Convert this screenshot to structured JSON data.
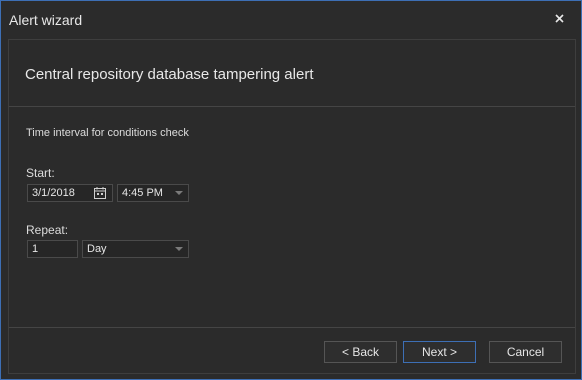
{
  "window": {
    "title": "Alert wizard"
  },
  "header": {
    "title": "Central repository database tampering alert"
  },
  "section": {
    "label": "Time interval for conditions check"
  },
  "start": {
    "label": "Start:",
    "date_value": "3/1/2018",
    "time_value": "4:45 PM"
  },
  "repeat": {
    "label": "Repeat:",
    "count_value": "1",
    "unit_value": "Day"
  },
  "buttons": {
    "back": "< Back",
    "next": "Next >",
    "cancel": "Cancel"
  },
  "colors": {
    "accent": "#3d6fb5",
    "background": "#2b2b2b"
  },
  "icons": {
    "close": "close-icon",
    "calendar": "calendar-icon",
    "dropdown": "chevron-down-icon"
  }
}
